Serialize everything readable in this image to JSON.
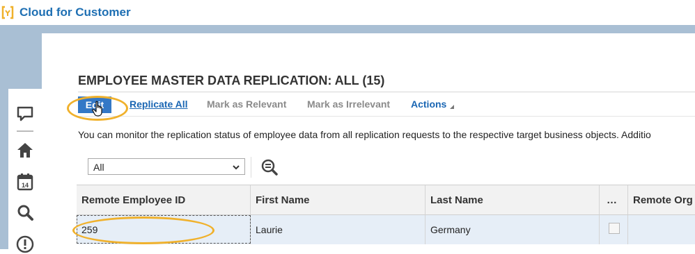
{
  "app": {
    "title": "Cloud for Customer",
    "logo_icon": "sap-logo-icon"
  },
  "nav": {
    "icons": [
      "feed-icon",
      "home-icon",
      "calendar-icon",
      "search-icon",
      "alert-icon"
    ],
    "calendar_day": "14"
  },
  "page": {
    "title": "EMPLOYEE MASTER DATA REPLICATION: ALL (15)",
    "description": "You can monitor the replication status of employee data from all replication requests to the respective target business objects. Additio"
  },
  "toolbar": {
    "edit_label": "Edit",
    "replicate_all_label": "Replicate All",
    "mark_relevant_label": "Mark as Relevant",
    "mark_irrelevant_label": "Mark as Irrelevant",
    "actions_label": "Actions"
  },
  "filter": {
    "selected": "All",
    "search_icon": "zoom-icon"
  },
  "table": {
    "columns": [
      "Remote Employee ID",
      "First Name",
      "Last Name",
      "…",
      "Remote Org"
    ],
    "rows": [
      {
        "remote_employee_id": "259",
        "first_name": "Laurie",
        "last_name": "Germany",
        "checked": false
      }
    ]
  },
  "colors": {
    "accent": "#3478c6",
    "link": "#1a66b3",
    "brand": "#1e6fb3",
    "highlight": "#f0b12c",
    "shell": "#a9bfd4"
  }
}
